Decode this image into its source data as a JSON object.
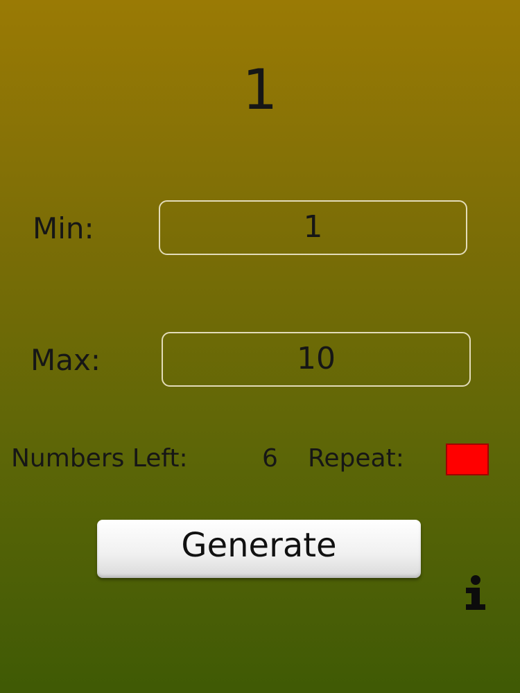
{
  "result": {
    "value": "1"
  },
  "min": {
    "label": "Min:",
    "value": "1"
  },
  "max": {
    "label": "Max:",
    "value": "10"
  },
  "status": {
    "numbers_left_label": "Numbers Left:",
    "numbers_left_value": "6",
    "repeat_label": "Repeat:",
    "repeat_color": "#ff0000"
  },
  "actions": {
    "generate_label": "Generate",
    "info_icon": "info-icon"
  },
  "theme": {
    "gradient_top": "#9a7a05",
    "gradient_bottom": "#3f5a05"
  }
}
